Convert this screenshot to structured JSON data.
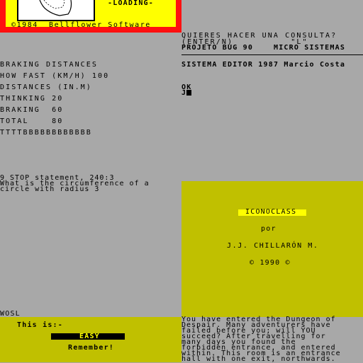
{
  "top_left": {
    "loading": "-LOADING-",
    "copyright": "©1984  Bellflower Software"
  },
  "top_right": {
    "line1": "QUIERES HACER UNA CONSULTA?",
    "line2": "(ENTER/N)          \"L\"",
    "line3": "PROJETO BUG 90    MICRO SISTEMAS",
    "line4": "SISTEMA EDITOR 1987 Marcio Costa",
    "ok": "OK",
    "prompt": "J"
  },
  "braking": {
    "title": "BRAKING DISTANCES",
    "how_fast": "HOW FAST (KM/H) 100",
    "distances": "DISTANCES (IN.M)",
    "thinking": "THINKING 20",
    "braking": "BRAKING  60",
    "total": "TOTAL    80",
    "bar_text": "TTTTBBBBBBBBBBBB"
  },
  "program": {
    "stop": "9 STOP statement, 240:3",
    "q1": "What is the circumference of a",
    "q2": "circle with radius 3"
  },
  "credits": {
    "title": "ICONOCLASS",
    "por": "por",
    "author": "J.J. CHILLARÓN M.",
    "year": "© 1990 ©"
  },
  "input_line": "WOSL",
  "bottom_left": {
    "this_is": "This is:-",
    "level": "EASY",
    "remember": "Remember!"
  },
  "dungeon": {
    "lines": [
      "You have entered the Dungeon of",
      "Despair. Many adventurers have",
      "failed before you; will YOU",
      "succeed? After travelling for",
      "many days you found the",
      "forbidden entrance, and entered",
      "within. This room is an entrance",
      "hall with one exit, northwards."
    ]
  },
  "colors": {
    "background": "#a8a8a8",
    "red_border": "#ff1010",
    "yellow": "#ffff00",
    "olive": "#c0c000"
  }
}
